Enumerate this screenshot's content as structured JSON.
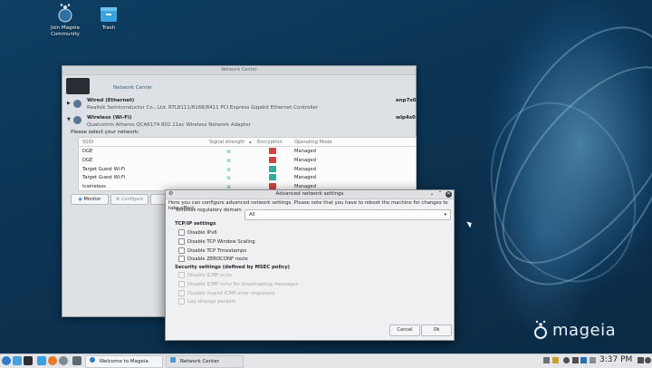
{
  "desktop": {
    "icons": [
      {
        "label_line1": "Join Mageia",
        "label_line2": "Community",
        "icon": "mageia-community-icon"
      },
      {
        "label_line1": "Trash",
        "label_line2": "",
        "icon": "trash-icon"
      }
    ],
    "brand": "mageia"
  },
  "network_center": {
    "window_title": "Network Center",
    "header": "Network Center",
    "wired": {
      "title": "Wired (Ethernet)",
      "device": "Realtek Semiconductor Co., Ltd. RTL8111/8168/8411 PCI Express Gigabit Ethernet Controller",
      "iface": "enp7s0"
    },
    "wireless": {
      "title": "Wireless (Wi-Fi)",
      "device": "Qualcomm Atheros QCA6174 802.11ac Wireless Network Adapter",
      "iface": "wlp4s0"
    },
    "prompt": "Please select your network:",
    "columns": {
      "ssid": "SSID",
      "signal": "Signal strength",
      "encryption": "Encryption",
      "mode": "Operating Mode"
    },
    "networks": [
      {
        "ssid": "DGE",
        "mode": "Managed",
        "encrypted": true
      },
      {
        "ssid": "DGE",
        "mode": "Managed",
        "encrypted": true
      },
      {
        "ssid": "Target Guest Wi-Fi",
        "mode": "Managed",
        "encrypted": false
      },
      {
        "ssid": "Target Guest Wi-Fi",
        "mode": "Managed",
        "encrypted": false
      },
      {
        "ssid": "tcwireless",
        "mode": "Managed",
        "encrypted": true
      }
    ],
    "buttons": {
      "monitor": "Monitor",
      "configure": "Configure"
    }
  },
  "dialog": {
    "title": "Advanced network settings",
    "intro": "Here you can configure advanced network settings. Please note that you have to reboot the machine for changes to take effect.",
    "domain_label": "Wireless regulatory domain",
    "domain_value": "All",
    "tcpip_title": "TCP/IP settings",
    "tcpip_options": [
      "Disable IPv6",
      "Disable TCP Window Scaling",
      "Disable TCP Timestamps",
      "Disable ZEROCONF route"
    ],
    "security_title": "Security settings (defined by MSEC policy)",
    "security_options": [
      "Disable ICMP echo",
      "Disable ICMP echo for broadcasting messages",
      "Disable invalid ICMP error responses",
      "Log strange packets"
    ],
    "cancel": "Cancel",
    "ok": "Ok"
  },
  "taskbar": {
    "tasks": [
      "Welcome to Mageia",
      "Network Center"
    ],
    "clock": "3:37 PM"
  }
}
